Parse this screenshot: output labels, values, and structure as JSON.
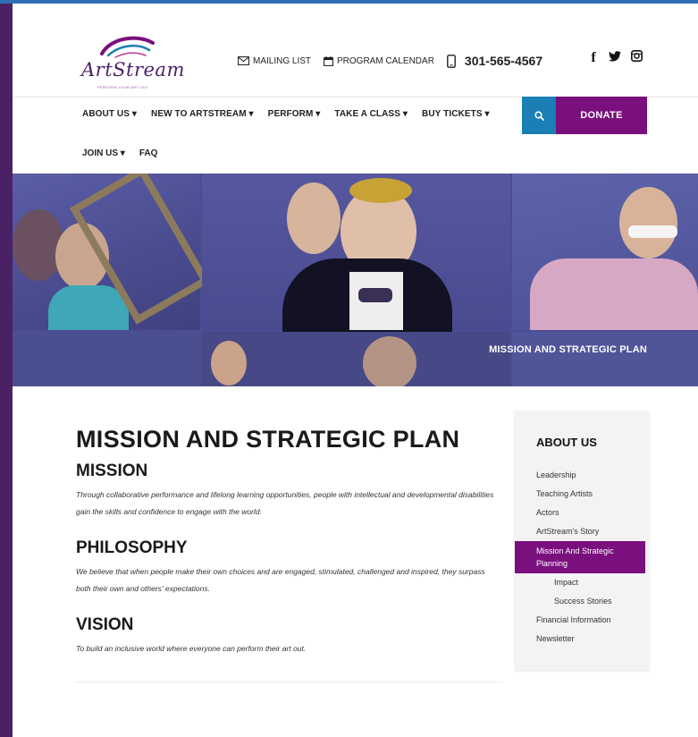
{
  "logo": {
    "name": "ArtStream",
    "tagline": "PERFORM YOUR ART OUT"
  },
  "utility": {
    "mailing_list": "MAILING LIST",
    "program_calendar": "PROGRAM CALENDAR",
    "phone": "301-565-4567"
  },
  "social": {
    "facebook": "f",
    "twitter": "twitter",
    "instagram": "instagram"
  },
  "nav": {
    "items": [
      {
        "label": "ABOUT US"
      },
      {
        "label": "NEW TO ARTSTREAM"
      },
      {
        "label": "PERFORM"
      },
      {
        "label": "TAKE A CLASS"
      },
      {
        "label": "BUY TICKETS"
      }
    ],
    "row2": [
      {
        "label": "JOIN US"
      },
      {
        "label": "FAQ"
      }
    ],
    "donate": "DONATE"
  },
  "hero": {
    "caption": "MISSION AND STRATEGIC PLAN"
  },
  "content": {
    "title": "MISSION AND STRATEGIC PLAN",
    "sections": [
      {
        "heading": "MISSION",
        "body": "Through collaborative performance and lifelong learning opportunities, people with intellectual and developmental disabilities gain the skills and confidence to engage with the world."
      },
      {
        "heading": "PHILOSOPHY",
        "body": "We believe that when people make their own choices and are engaged, stimulated, challenged and inspired, they surpass both their own and others' expectations."
      },
      {
        "heading": "VISION",
        "body": "To build an inclusive world where everyone can perform their art out."
      }
    ]
  },
  "sidebar": {
    "title": "ABOUT US",
    "items": [
      {
        "label": "Leadership"
      },
      {
        "label": "Teaching Artists"
      },
      {
        "label": "Actors"
      },
      {
        "label": "ArtStream's Story"
      },
      {
        "label": "Mission And Strategic Planning"
      },
      {
        "label": "Impact"
      },
      {
        "label": "Success Stories"
      },
      {
        "label": "Financial Information"
      },
      {
        "label": "Newsletter"
      }
    ]
  },
  "colors": {
    "brand_purple": "#7a0f7e",
    "search_blue": "#1a7fb5",
    "left_stripe": "#4b2166"
  }
}
